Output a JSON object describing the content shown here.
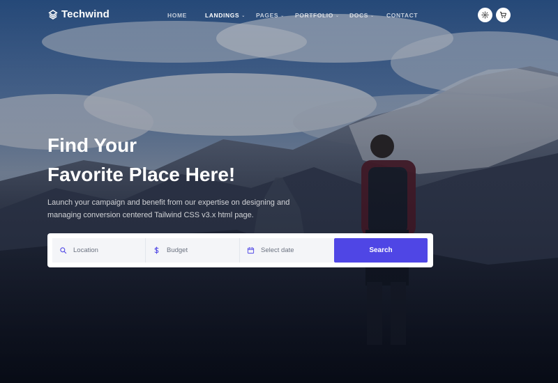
{
  "brand": {
    "name": "Techwind",
    "icon": "logo-mark-icon"
  },
  "nav": {
    "items": [
      {
        "label": "HOME",
        "has_dropdown": false,
        "active": false
      },
      {
        "label": "LANDINGS",
        "has_dropdown": true,
        "active": true
      },
      {
        "label": "PAGES",
        "has_dropdown": true,
        "active": false
      },
      {
        "label": "PORTFOLIO",
        "has_dropdown": true,
        "active": false
      },
      {
        "label": "DOCS",
        "has_dropdown": true,
        "active": false
      },
      {
        "label": "CONTACT",
        "has_dropdown": false,
        "active": false
      }
    ],
    "actions": [
      {
        "icon": "gear-icon"
      },
      {
        "icon": "cart-icon"
      }
    ]
  },
  "hero": {
    "title_line1": "Find Your",
    "title_line2": "Favorite Place Here!",
    "description": "Launch your campaign and benefit from our expertise on designing and managing conversion centered Tailwind CSS v3.x html page."
  },
  "search": {
    "location_placeholder": "Location",
    "budget_placeholder": "Budget",
    "date_placeholder": "Select date",
    "button_label": "Search"
  },
  "colors": {
    "accent": "#4f46e5",
    "field_bg": "#f4f5f8"
  }
}
